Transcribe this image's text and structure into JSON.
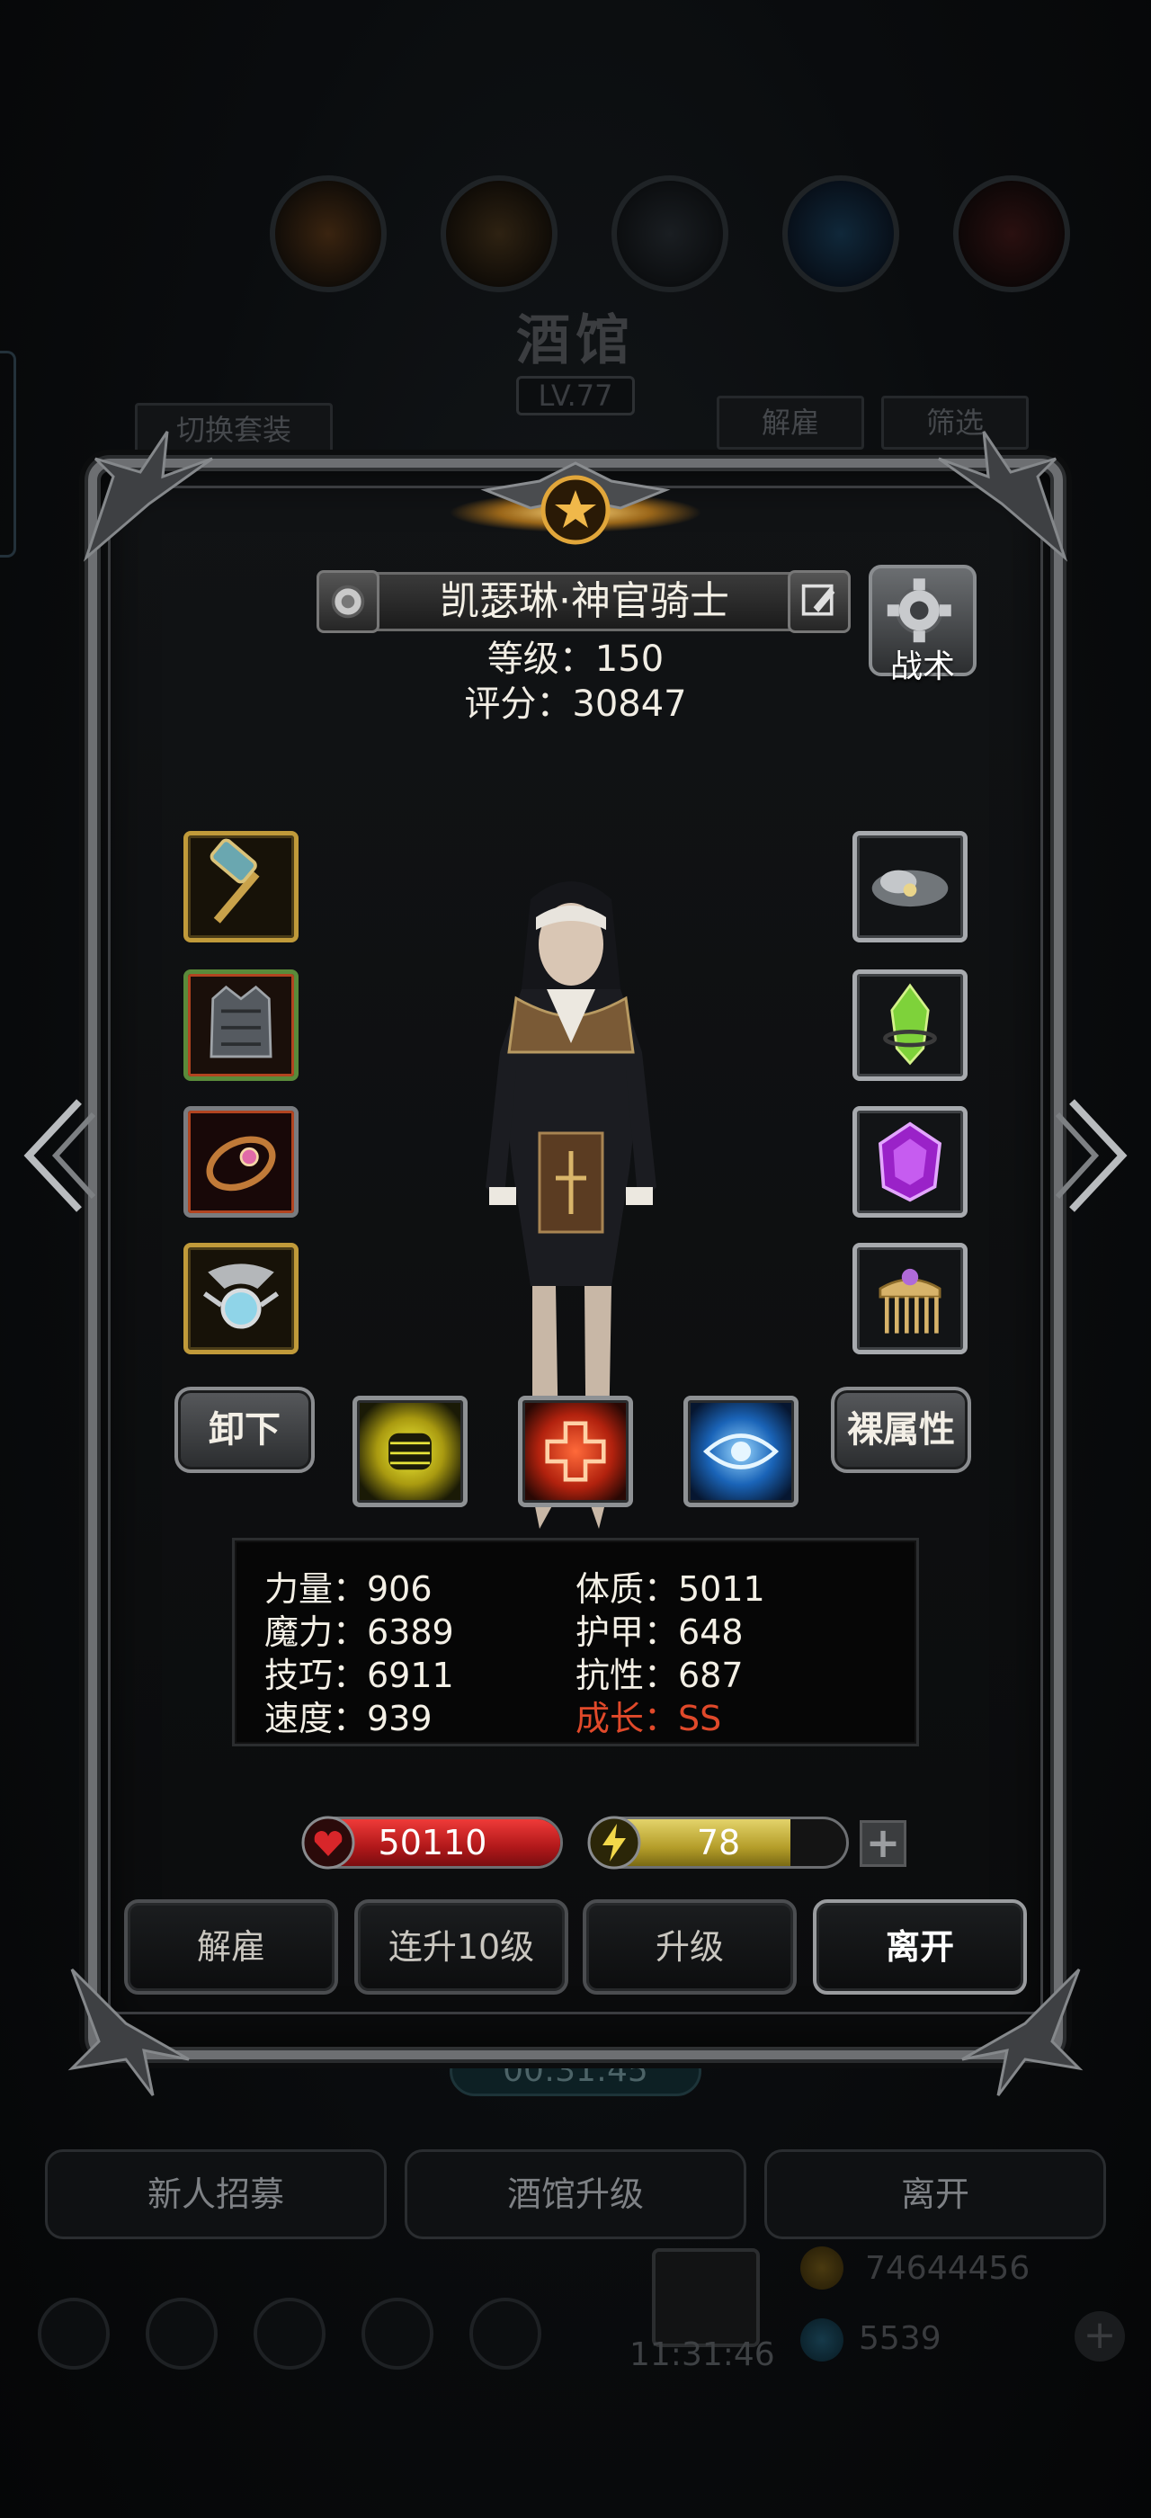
{
  "background": {
    "title": "酒馆",
    "level": "LV.77",
    "switch_outfit": "切换套装",
    "dismiss": "解雇",
    "filter": "筛选",
    "timer": "00:31:45",
    "bottom_buttons": [
      "新人招募",
      "酒馆升级",
      "离开"
    ],
    "clock": "11:31:46",
    "gold": "74644456",
    "gems": "5539"
  },
  "hero": {
    "name": "凯瑟琳·神官骑士",
    "level_label": "等级：150",
    "score_label": "评分：30847",
    "tactics": "战术"
  },
  "actions": {
    "unequip": "卸下",
    "naked_attributes": "裸属性"
  },
  "attribute_icons": [
    "fist-icon",
    "medical-cross-icon",
    "eye-icon"
  ],
  "equipment": {
    "left": [
      "hammer-icon",
      "spiked-armor-icon",
      "ring-icon",
      "amulet-icon"
    ],
    "right": [
      "cloud-ring-icon",
      "green-crystal-icon",
      "purple-gem-icon",
      "comb-icon"
    ]
  },
  "stats": [
    {
      "label": "力量：906"
    },
    {
      "label": "魔力：6389"
    },
    {
      "label": "技巧：6911"
    },
    {
      "label": "速度：939"
    },
    {
      "label": "体质：5011"
    },
    {
      "label": "护甲：648"
    },
    {
      "label": "抗性：687"
    },
    {
      "label": "成长：SS"
    }
  ],
  "bars": {
    "hp": "50110",
    "hp_fill": 1.0,
    "energy": "78",
    "energy_fill": 0.78,
    "plus": "+"
  },
  "panel_buttons": {
    "dismiss": "解雇",
    "level_up_10": "连升10级",
    "level_up": "升级",
    "leave": "离开"
  },
  "colors": {
    "growth": "#e0492a",
    "hp": "#d02426",
    "energy": "#c9b43c"
  }
}
